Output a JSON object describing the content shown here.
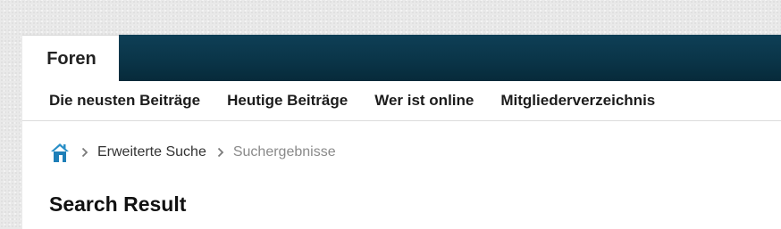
{
  "top_nav": {
    "active_tab_label": "Foren",
    "background_color": "#0b3448"
  },
  "sub_nav": {
    "items": [
      {
        "label": "Die neusten Beiträge"
      },
      {
        "label": "Heutige Beiträge"
      },
      {
        "label": "Wer ist online"
      },
      {
        "label": "Mitgliederverzeichnis"
      }
    ]
  },
  "breadcrumb": {
    "home_icon": "home-icon",
    "separator_icon": "chevron-right-icon",
    "items": [
      {
        "label": "Erweiterte Suche"
      },
      {
        "label": "Suchergebnisse"
      }
    ]
  },
  "main": {
    "title": "Search Result"
  }
}
